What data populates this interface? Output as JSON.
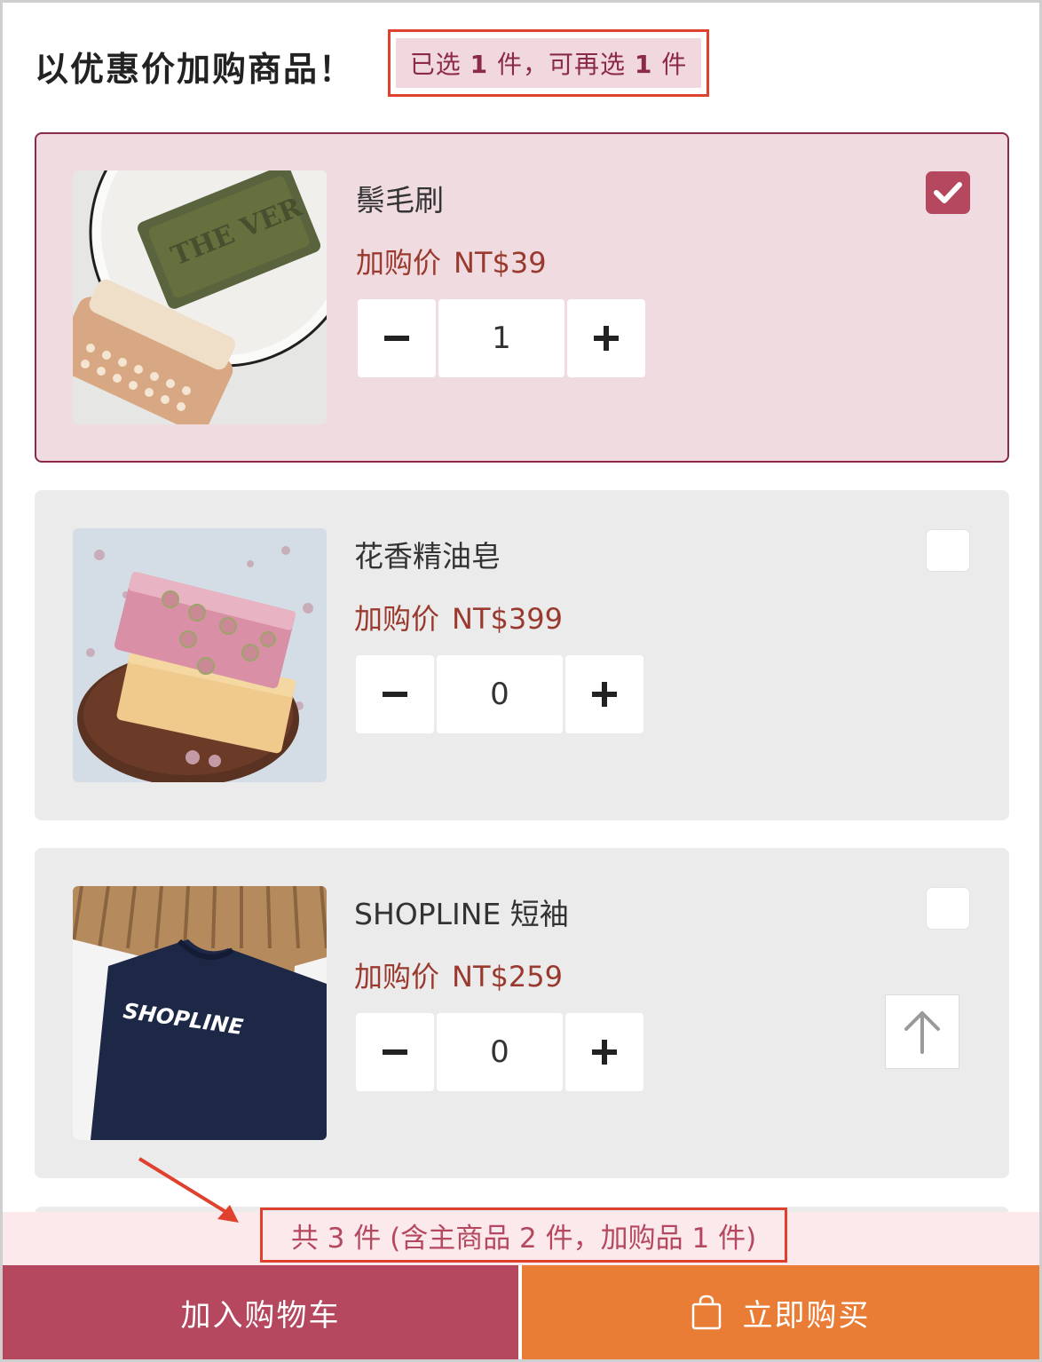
{
  "header": {
    "title": "以优惠价加购商品！",
    "hint_prefix": "已选 ",
    "selected_count": "1",
    "hint_middle": " 件，可再选 ",
    "remaining_count": "1",
    "hint_suffix": " 件"
  },
  "products": [
    {
      "name": "鬃毛刷",
      "price_label": "加购价",
      "price": "NT$39",
      "quantity": "1",
      "selected": true
    },
    {
      "name": "花香精油皂",
      "price_label": "加购价",
      "price": "NT$399",
      "quantity": "0",
      "selected": false
    },
    {
      "name": "SHOPLINE 短袖",
      "price_label": "加购价",
      "price": "NT$259",
      "quantity": "0",
      "selected": false,
      "shirt_print": "SHOPLINE"
    }
  ],
  "summary": "共 3 件 (含主商品 2 件，加购品 1 件)",
  "footer": {
    "add_to_cart": "加入购物车",
    "buy_now": "立即购买"
  },
  "colors": {
    "brand": "#b5485f",
    "price": "#9a3a2e",
    "buy_now": "#e97d36",
    "highlight_box": "#e0412f"
  },
  "icons": [
    "minus-icon",
    "plus-icon",
    "checkmark-icon",
    "arrow-up-icon",
    "shopping-bag-icon"
  ]
}
